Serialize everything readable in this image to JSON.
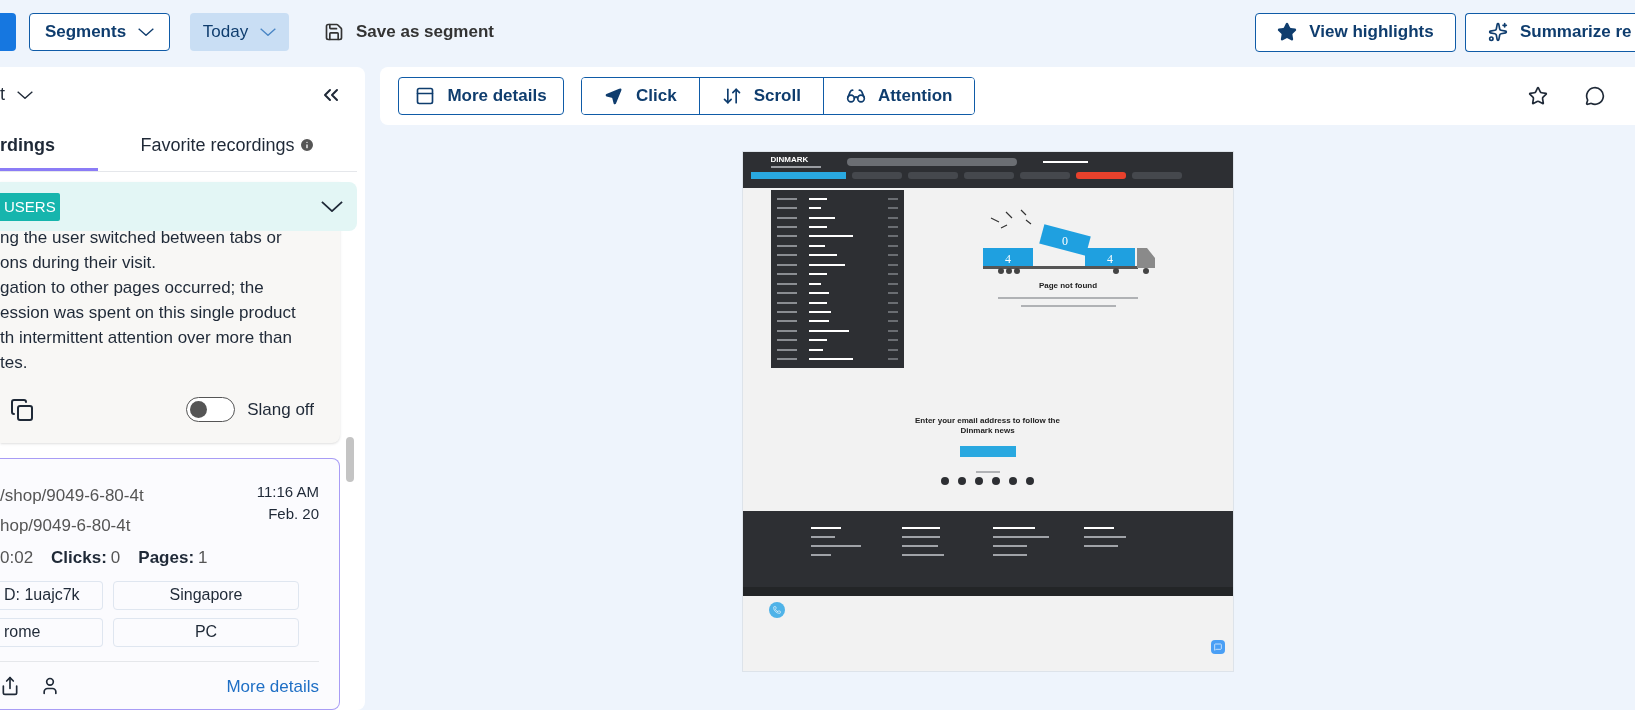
{
  "topbar": {
    "segments": "Segments",
    "date": "Today",
    "save": "Save as segment",
    "highlights": "View highlights",
    "summarize": "Summarize re"
  },
  "sidebar": {
    "filter": "t",
    "tabs": [
      {
        "label": "rdings",
        "selected": true,
        "info": false
      },
      {
        "label": "Favorite recordings",
        "selected": false,
        "info": true
      }
    ],
    "summary": {
      "badge": "USERS",
      "expanded": true,
      "lines": [
        "ng the user switched between tabs or",
        "ons during their visit.",
        "gation to other pages occurred; the",
        "ession was spent on this single product",
        "th intermittent attention over more than",
        "tes."
      ],
      "slang": {
        "on": false,
        "label": "Slang off"
      }
    },
    "recording": {
      "entry_url": "/shop/9049-6-80-4t",
      "exit_url": "hop/9049-6-80-4t",
      "time": "11:16 AM",
      "date": "Feb. 20",
      "duration": "0:02",
      "clicks_label": "Clicks:",
      "clicks": "0",
      "pages_label": "Pages:",
      "pages": "1",
      "chips": [
        "D: 1uajc7k",
        "Singapore",
        "rome",
        "PC"
      ],
      "link": "More details"
    }
  },
  "toolbar": {
    "details": "More details",
    "modes": [
      {
        "label": "Click",
        "kind": "click",
        "selected": false
      },
      {
        "label": "Scroll",
        "kind": "scroll",
        "selected": false
      },
      {
        "label": "Attention",
        "kind": "attention",
        "selected": false
      }
    ]
  },
  "site": {
    "logo": "DINMARK",
    "nav": [
      {
        "selected": false
      },
      {
        "selected": false
      },
      {
        "selected": false
      },
      {
        "selected": false
      },
      {
        "selected": true
      },
      {
        "selected": false
      }
    ],
    "digits": [
      "4",
      "0",
      "4"
    ],
    "title": "Page not found",
    "newsletter": "Enter your email address to follow the Dinmark news"
  }
}
